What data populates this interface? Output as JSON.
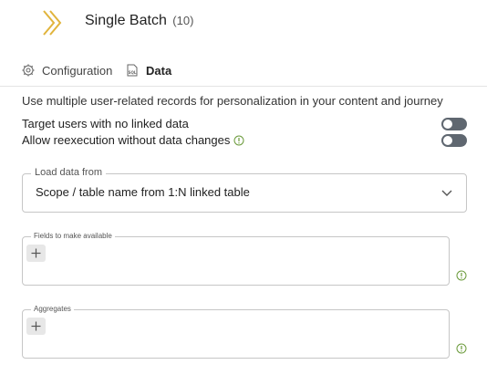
{
  "header": {
    "title": "Single Batch",
    "count": "(10)",
    "logo_icon": "double-chevron-logo",
    "logo_color": "#e1b43c"
  },
  "tabs": [
    {
      "label": "Configuration",
      "icon": "gear-icon",
      "active": false
    },
    {
      "label": "Data",
      "icon": "sql-icon",
      "active": true
    }
  ],
  "description": "Use multiple user-related records for personalization in your content and journey",
  "toggles": [
    {
      "label": "Target users with no linked data",
      "on": false,
      "info": false
    },
    {
      "label": "Allow reexecution without data changes",
      "on": false,
      "info": true
    }
  ],
  "load_data": {
    "legend": "Load data from",
    "value": "Scope / table name from 1:N linked table"
  },
  "fields_available": {
    "legend": "Fields to make available",
    "add_icon": "plus-icon"
  },
  "aggregates": {
    "legend": "Aggregates",
    "add_icon": "plus-icon"
  },
  "colors": {
    "accent": "#e1b43c",
    "toggle_off": "#5f6770",
    "info_green": "#6a9a3a"
  }
}
